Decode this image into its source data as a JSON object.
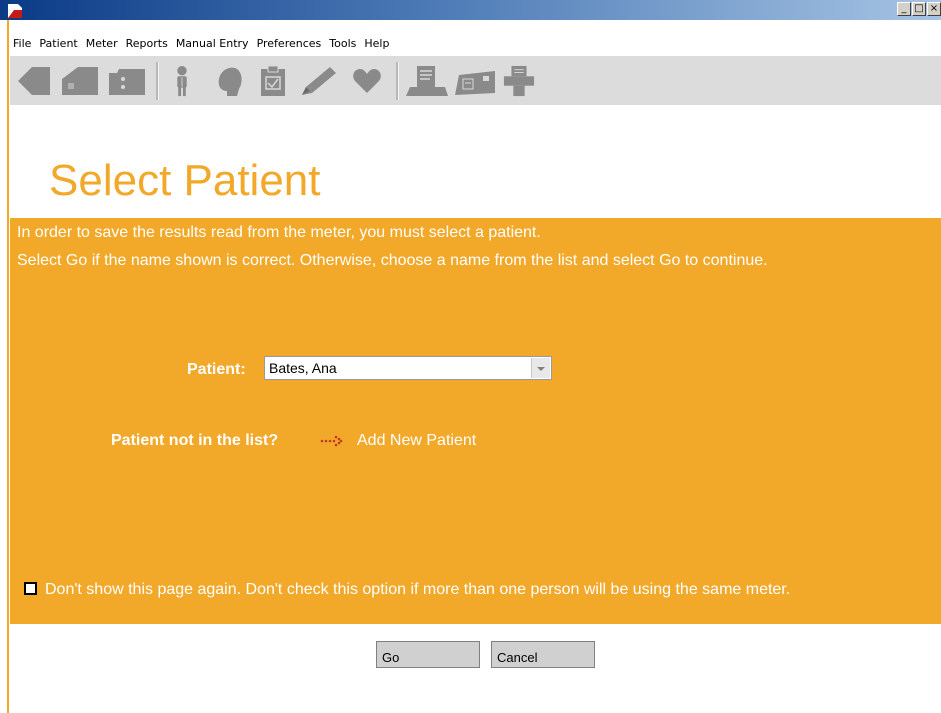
{
  "window": {
    "minimize_glyph": "_",
    "maximize_glyph": "□",
    "close_glyph": "×"
  },
  "menubar": {
    "items": [
      "File",
      "Patient",
      "Meter",
      "Reports",
      "Manual Entry",
      "Preferences",
      "Tools",
      "Help"
    ]
  },
  "toolbar": {
    "icons": [
      "back-arrow-icon",
      "home-icon",
      "folder-icon",
      "person-icon",
      "head-icon",
      "clipboard-icon",
      "pencil-icon",
      "heart-icon",
      "document-icon",
      "meter-icon",
      "printer-icon"
    ]
  },
  "page": {
    "title": "Select Patient",
    "intro_line1": "In order to save the results read from the meter, you must select a patient.",
    "intro_line2": "Select Go if the name shown is correct. Otherwise, choose a name from the list and select Go to continue."
  },
  "form": {
    "patient_label": "Patient:",
    "patient_value": "Bates, Ana",
    "not_in_list_label": "Patient not in the list?",
    "add_new_patient": "Add New Patient",
    "dont_show_checked": false,
    "dont_show_text": "Don't show this page again. Don't check this option if more than one person will be using the same meter."
  },
  "buttons": {
    "go": "Go",
    "cancel": "Cancel"
  },
  "colors": {
    "accent": "#f2a829",
    "titlebar_start": "#0b3a86",
    "toolbar_bg": "#dcdcdc",
    "icon_gray": "#8a8a8a"
  }
}
